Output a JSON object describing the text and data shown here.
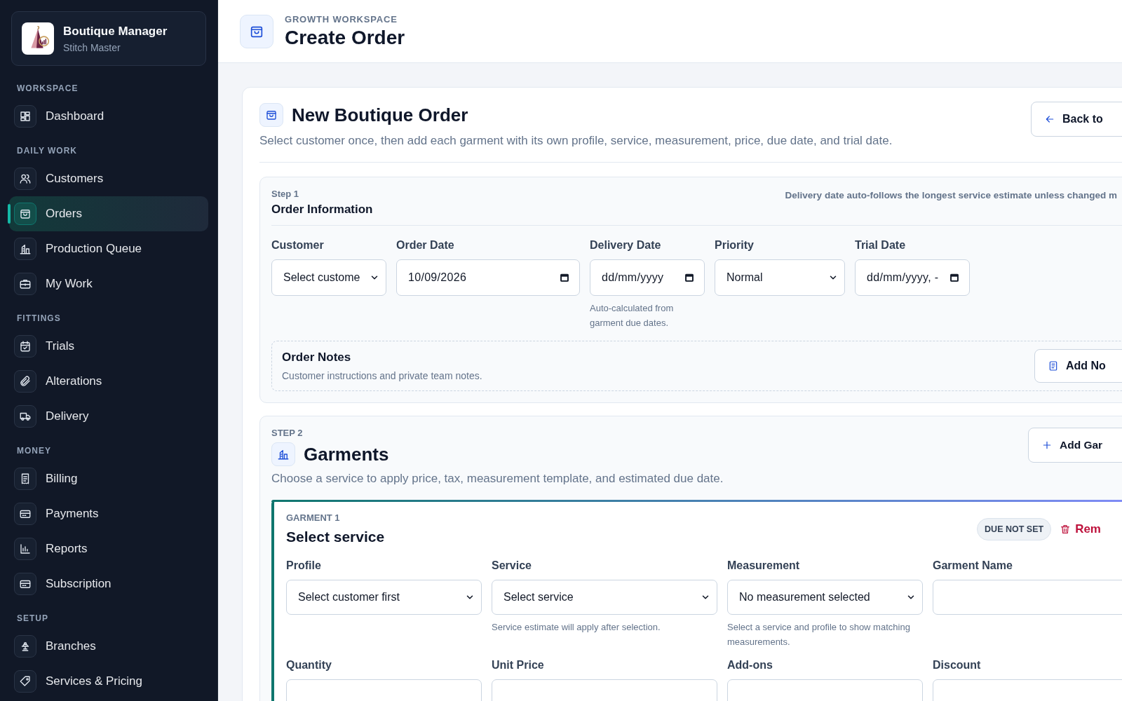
{
  "sidebar": {
    "brand": {
      "title": "Boutique Manager",
      "subtitle": "Stitch Master"
    },
    "sections": [
      {
        "label": "WORKSPACE",
        "items": [
          {
            "label": "Dashboard",
            "selected": false
          }
        ]
      },
      {
        "label": "DAILY WORK",
        "items": [
          {
            "label": "Customers",
            "selected": false
          },
          {
            "label": "Orders",
            "selected": true
          },
          {
            "label": "Production Queue",
            "selected": false
          },
          {
            "label": "My Work",
            "selected": false
          }
        ]
      },
      {
        "label": "FITTINGS",
        "items": [
          {
            "label": "Trials",
            "selected": false
          },
          {
            "label": "Alterations",
            "selected": false
          },
          {
            "label": "Delivery",
            "selected": false
          }
        ]
      },
      {
        "label": "MONEY",
        "items": [
          {
            "label": "Billing",
            "selected": false
          },
          {
            "label": "Payments",
            "selected": false
          },
          {
            "label": "Reports",
            "selected": false
          },
          {
            "label": "Subscription",
            "selected": false
          }
        ]
      },
      {
        "label": "SETUP",
        "items": [
          {
            "label": "Branches",
            "selected": false
          },
          {
            "label": "Services & Pricing",
            "selected": false
          }
        ]
      }
    ]
  },
  "header": {
    "eyebrow": "GROWTH WORKSPACE",
    "title": "Create Order"
  },
  "order_card": {
    "title": "New Boutique Order",
    "subtitle": "Select customer once, then add each garment with its own profile, service, measurement, price, due date, and trial date.",
    "back_button": "Back to",
    "step1": {
      "step": "Step 1",
      "title": "Order Information",
      "note": "Delivery date auto-follows the longest service estimate unless changed m",
      "fields": [
        {
          "label": "Customer",
          "kind": "select",
          "value": "Select custome"
        },
        {
          "label": "Order Date",
          "kind": "date",
          "value": "10/09/2026"
        },
        {
          "label": "Delivery Date",
          "kind": "date",
          "placeholder": "dd/mm/yyyy",
          "hint": "Auto-calculated from garment due dates."
        },
        {
          "label": "Priority",
          "kind": "select",
          "value": "Normal"
        },
        {
          "label": "Trial Date",
          "kind": "date",
          "placeholder": "dd/mm/yyyy, -"
        }
      ],
      "notes": {
        "title": "Order Notes",
        "subtitle": "Customer instructions and private team notes.",
        "button": "Add No"
      }
    },
    "step2": {
      "step": "STEP 2",
      "title": "Garments",
      "subtitle": "Choose a service to apply price, tax, measurement template, and estimated due date.",
      "button": "Add Gar",
      "garments": [
        {
          "eyebrow": "GARMENT 1",
          "title": "Select service",
          "badge": "DUE NOT SET",
          "remove": "Rem",
          "fields": [
            {
              "label": "Profile",
              "kind": "select",
              "value": "Select customer first"
            },
            {
              "label": "Service",
              "kind": "select",
              "value": "Select service",
              "hint": "Service estimate will apply after selection."
            },
            {
              "label": "Measurement",
              "kind": "select",
              "value": "No measurement selected",
              "hint": "Select a service and profile to show matching measurements."
            },
            {
              "label": "Garment Name",
              "kind": "text"
            },
            {
              "label": "Quantity",
              "kind": "text"
            },
            {
              "label": "Unit Price",
              "kind": "text"
            },
            {
              "label": "Add-ons",
              "kind": "text"
            },
            {
              "label": "Discount",
              "kind": "text"
            }
          ]
        }
      ]
    }
  }
}
